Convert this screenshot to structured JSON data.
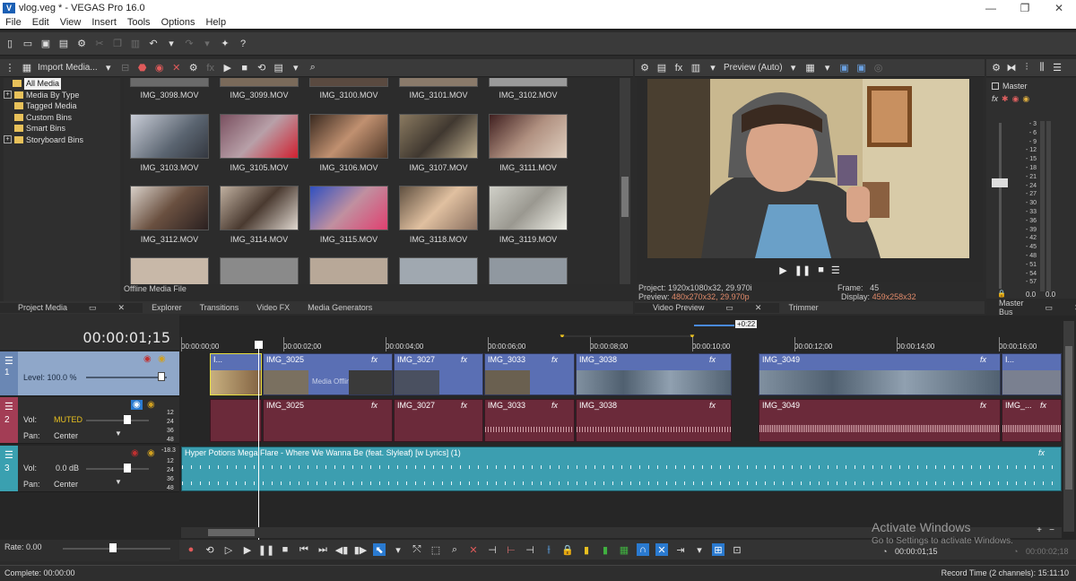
{
  "window": {
    "title": "vlog.veg * - VEGAS Pro 16.0",
    "controls": [
      "—",
      "❐",
      "✕"
    ]
  },
  "menu": [
    "File",
    "Edit",
    "View",
    "Insert",
    "Tools",
    "Options",
    "Help"
  ],
  "media_toolbar": {
    "import_label": "Import Media..."
  },
  "media_tree": [
    {
      "label": "All Media",
      "selected": true,
      "expand": ""
    },
    {
      "label": "Media By Type",
      "selected": false,
      "expand": "+"
    },
    {
      "label": "Tagged Media",
      "selected": false,
      "expand": ""
    },
    {
      "label": "Custom Bins",
      "selected": false,
      "expand": ""
    },
    {
      "label": "Smart Bins",
      "selected": false,
      "expand": ""
    },
    {
      "label": "Storyboard Bins",
      "selected": false,
      "expand": "+"
    }
  ],
  "media_files_row0": [
    "IMG_3098.MOV",
    "IMG_3099.MOV",
    "IMG_3100.MOV",
    "IMG_3101.MOV",
    "IMG_3102.MOV"
  ],
  "media_files_row1": [
    "IMG_3103.MOV",
    "IMG_3105.MOV",
    "IMG_3106.MOV",
    "IMG_3107.MOV",
    "IMG_3111.MOV"
  ],
  "media_files_row2": [
    "IMG_3112.MOV",
    "IMG_3114.MOV",
    "IMG_3115.MOV",
    "IMG_3118.MOV",
    "IMG_3119.MOV"
  ],
  "offline_label": "Offline Media File",
  "left_tabs": [
    "Project Media",
    "Explorer",
    "Transitions",
    "Video FX",
    "Media Generators"
  ],
  "preview": {
    "toolbar_label": "Preview (Auto)",
    "project_label": "Project:",
    "project_value": "1920x1080x32, 29.970i",
    "preview_label": "Preview:",
    "preview_value": "480x270x32, 29.970p",
    "frame_label": "Frame:",
    "frame_value": "45",
    "display_label": "Display:",
    "display_value": "459x258x32",
    "tabs": [
      "Video Preview",
      "Trimmer"
    ]
  },
  "master": {
    "label": "Master",
    "tab": "Master Bus",
    "scale": [
      "3",
      "6",
      "9",
      "12",
      "15",
      "18",
      "21",
      "24",
      "27",
      "30",
      "33",
      "36",
      "39",
      "42",
      "45",
      "48",
      "51",
      "54",
      "57"
    ],
    "bottom": [
      "0.0",
      "0.0"
    ]
  },
  "timeline": {
    "timecode": "00:00:01;15",
    "ruler": [
      "00:00:00;00",
      "00:00:02;00",
      "00:00:04;00",
      "00:00:06;00",
      "00:00:08;00",
      "00:00:10;00",
      "00:00:12;00",
      "00:00:14;00",
      "00:00:16;00"
    ],
    "loop_label": "+0:22",
    "tracks": [
      {
        "num": "1",
        "level_label": "Level: 100.0 %"
      },
      {
        "num": "2",
        "vol_label": "Vol:",
        "vol_value": "MUTED",
        "pan_label": "Pan:",
        "pan_value": "Center",
        "db": [
          "12",
          "24",
          "36",
          "48"
        ]
      },
      {
        "num": "3",
        "vol_label": "Vol:",
        "vol_value": "0.0 dB",
        "pan_label": "Pan:",
        "pan_value": "Center",
        "db": [
          "-18.3",
          "12",
          "24",
          "36",
          "48"
        ]
      }
    ],
    "video_clips": [
      "I...",
      "IMG_3025",
      "IMG_3027",
      "IMG_3033",
      "IMG_3038",
      "IMG_3049",
      "I..."
    ],
    "audio_clips": [
      "IMG_3025",
      "IMG_3027",
      "IMG_3033",
      "IMG_3038",
      "IMG_3049",
      "IMG_..."
    ],
    "music_clip": "Hyper Potions  Mega Flare - Where We Wanna Be (feat. Slyleaf) [w Lyrics] (1)",
    "offline_text": "Media Offline",
    "fx_label": "fx"
  },
  "rate": "Rate: 0.00",
  "transport_time": "00:00:01;15",
  "transport_end": "00:00:02;18",
  "status": {
    "left": "Complete: 00:00:00",
    "right": "Record Time (2 channels): 15:11:10"
  },
  "watermark": {
    "line1": "Activate Windows",
    "line2": "Go to Settings to activate Windows."
  },
  "colors": {
    "video_clip": "#5a6fb4",
    "audio_clip": "#6b2a3a",
    "music_clip": "#3c9eb0",
    "track1_bar": "#8fa7c9",
    "track2_bar": "#a33d55",
    "track3_bar": "#3aa0b0"
  }
}
